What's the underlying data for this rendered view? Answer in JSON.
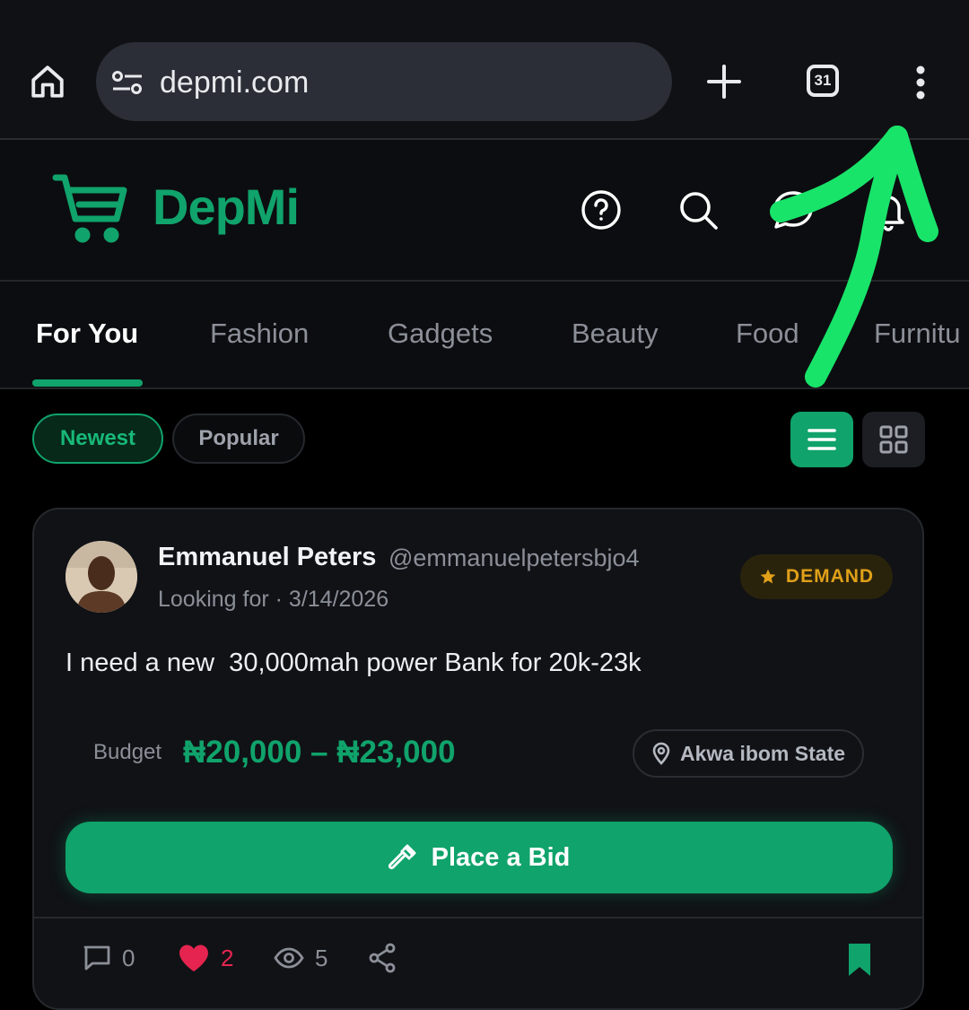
{
  "browser": {
    "url": "depmi.com",
    "tab_count": "31",
    "icons": [
      "home-icon",
      "site-settings-icon",
      "plus-icon",
      "tab-switcher-icon",
      "more-vertical-icon"
    ]
  },
  "header": {
    "brand": "DepMi",
    "icons": [
      "cart-logo-icon",
      "help-icon",
      "search-icon",
      "chat-icon",
      "bell-icon"
    ]
  },
  "tabs": [
    {
      "label": "For You",
      "active": true
    },
    {
      "label": "Fashion"
    },
    {
      "label": "Gadgets"
    },
    {
      "label": "Beauty"
    },
    {
      "label": "Food"
    },
    {
      "label": "Furnitu"
    }
  ],
  "filters": {
    "newest": "Newest",
    "popular": "Popular",
    "selected": "Newest",
    "view_mode": "list"
  },
  "post": {
    "author_name": "Emmanuel Peters",
    "author_handle": "@emmanuelpetersbjo4",
    "meta": "Looking for · 3/14/2026",
    "badge": "DEMAND",
    "text": "I need a new  30,000mah power Bank for 20k-23k",
    "budget_label": "Budget",
    "budget_value": "₦20,000 – ₦23,000",
    "location": "Akwa ibom State",
    "bid_button": "Place a Bid",
    "comments": "0",
    "likes": "2",
    "views": "5"
  },
  "colors": {
    "brand_green": "#10a36b",
    "annotation_green": "#19e46a",
    "demand_gold": "#e0a019",
    "like_red": "#e5244f"
  }
}
